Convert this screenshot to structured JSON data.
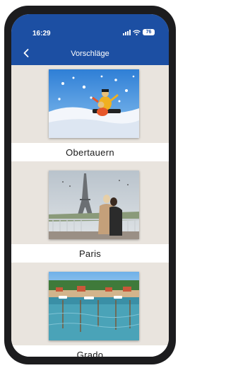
{
  "status_bar": {
    "time": "16:29",
    "battery": "76"
  },
  "nav": {
    "title": "Vorschläge",
    "back_icon": "chevron-left-icon"
  },
  "colors": {
    "appbar": "#1c4fa3",
    "background": "#e9e4de",
    "label_bg": "#ffffff"
  },
  "suggestions": [
    {
      "label": "Obertauern",
      "image": "snow-sledding-photo"
    },
    {
      "label": "Paris",
      "image": "eiffel-tower-couple-photo"
    },
    {
      "label": "Grado",
      "image": "harbor-boats-photo"
    }
  ]
}
